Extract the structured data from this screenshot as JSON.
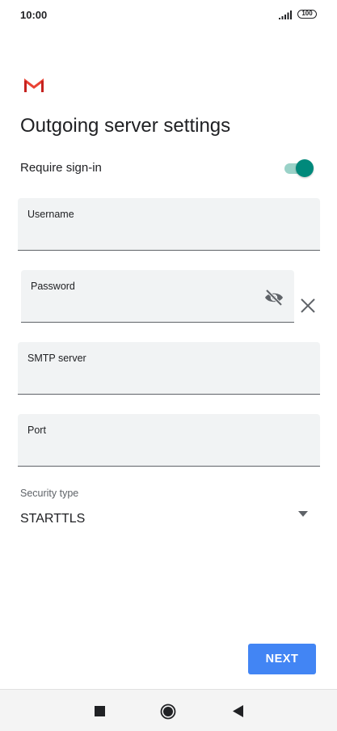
{
  "status_bar": {
    "time": "10:00",
    "battery": "100",
    "icons": [
      "signal-icon",
      "battery-icon"
    ]
  },
  "app": {
    "logo": "gmail-logo",
    "colors": {
      "gmail_red": "#ea4335",
      "toggle_on": "#00897b",
      "accent": "#4285f4"
    }
  },
  "page": {
    "title": "Outgoing server settings"
  },
  "require_signin": {
    "label": "Require sign-in",
    "enabled": true
  },
  "fields": {
    "username": {
      "label": "Username",
      "value": ""
    },
    "password": {
      "label": "Password",
      "value": "",
      "icons": [
        "eye-off-icon",
        "close-icon"
      ]
    },
    "smtp_server": {
      "label": "SMTP server",
      "value": ""
    },
    "port": {
      "label": "Port",
      "value": ""
    }
  },
  "security": {
    "label": "Security type",
    "value": "STARTTLS",
    "icon": "dropdown-arrow-icon"
  },
  "actions": {
    "next_label": "NEXT"
  },
  "nav_bar": {
    "icons": [
      "recents-icon",
      "home-icon",
      "back-icon"
    ]
  }
}
